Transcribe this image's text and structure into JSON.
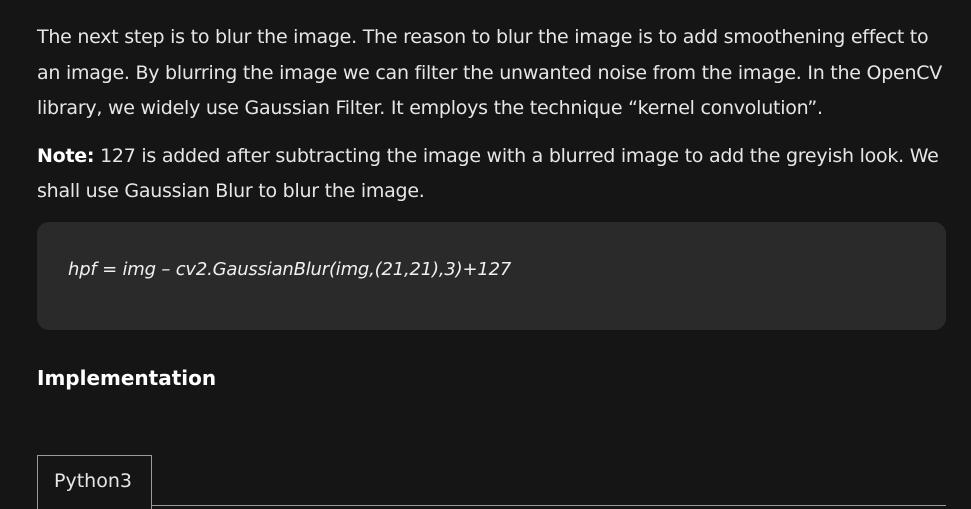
{
  "article": {
    "para1": "The next step is to blur the image. The reason to blur the image is to add smoothening effect to an image. By blurring the image we can filter the unwanted noise from the image. In the OpenCV library, we widely use Gaussian Filter. It employs the technique “kernel convolution”.",
    "note_label": "Note:",
    "note_text": " 127 is added after subtracting the image with a blurred image to add the greyish look. We shall use Gaussian Blur to blur the image."
  },
  "code_block": {
    "line": "hpf = img – cv2.GaussianBlur(img,(21,21),3)+127"
  },
  "section": {
    "heading": "Implementation"
  },
  "tabs": [
    {
      "label": "Python3",
      "active": true
    }
  ]
}
